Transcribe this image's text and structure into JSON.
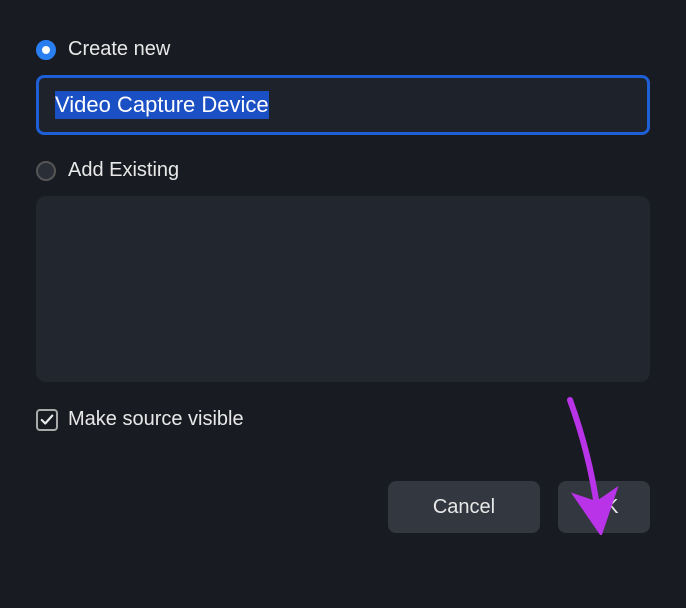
{
  "options": {
    "create_new_label": "Create new",
    "add_existing_label": "Add Existing",
    "make_visible_label": "Make source visible"
  },
  "input": {
    "source_name": "Video Capture Device"
  },
  "buttons": {
    "cancel": "Cancel",
    "ok": "OK"
  }
}
